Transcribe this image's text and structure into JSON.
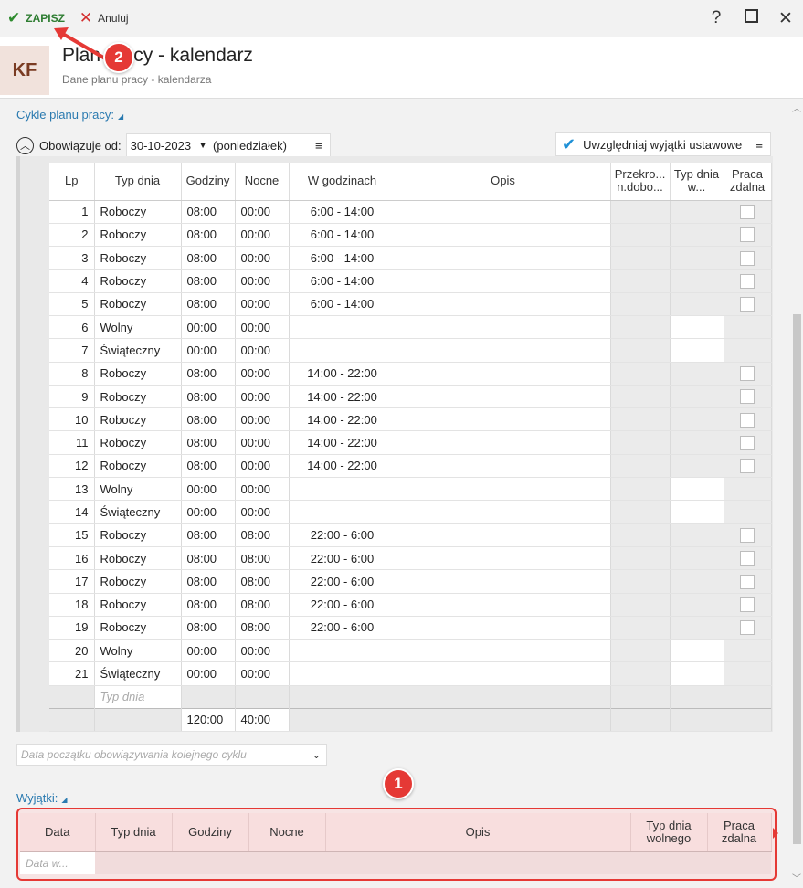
{
  "toolbar": {
    "save_label": "ZAPISZ",
    "cancel_label": "Anuluj",
    "help_label": "?",
    "close_label": "✕"
  },
  "header": {
    "avatar_initials": "KF",
    "title": "Plan pracy - kalendarz",
    "subtitle": "Dane planu pracy - kalendarza"
  },
  "cycles": {
    "section_label": "Cykle planu pracy:",
    "valid_from_label": "Obowiązuje od:",
    "valid_from_date": "30-10-2023",
    "valid_from_day": "(poniedziałek)",
    "include_exceptions_label": "Uwzględniaj wyjątki ustawowe",
    "columns": {
      "lp": "Lp",
      "typ": "Typ dnia",
      "godz": "Godziny",
      "noc": "Nocne",
      "wg": "W godzinach",
      "opis": "Opis",
      "prz": "Przekro... n.dobo...",
      "tdw": "Typ dnia w...",
      "pz": "Praca zdalna"
    },
    "rows": [
      {
        "lp": "1",
        "typ": "Roboczy",
        "godz": "08:00",
        "noc": "00:00",
        "wg": "6:00 - 14:00",
        "remote": true
      },
      {
        "lp": "2",
        "typ": "Roboczy",
        "godz": "08:00",
        "noc": "00:00",
        "wg": "6:00 - 14:00",
        "remote": true
      },
      {
        "lp": "3",
        "typ": "Roboczy",
        "godz": "08:00",
        "noc": "00:00",
        "wg": "6:00 - 14:00",
        "remote": true
      },
      {
        "lp": "4",
        "typ": "Roboczy",
        "godz": "08:00",
        "noc": "00:00",
        "wg": "6:00 - 14:00",
        "remote": true
      },
      {
        "lp": "5",
        "typ": "Roboczy",
        "godz": "08:00",
        "noc": "00:00",
        "wg": "6:00 - 14:00",
        "remote": true
      },
      {
        "lp": "6",
        "typ": "Wolny",
        "godz": "00:00",
        "noc": "00:00",
        "wg": "",
        "remote": false
      },
      {
        "lp": "7",
        "typ": "Świąteczny",
        "godz": "00:00",
        "noc": "00:00",
        "wg": "",
        "remote": false
      },
      {
        "lp": "8",
        "typ": "Roboczy",
        "godz": "08:00",
        "noc": "00:00",
        "wg": "14:00 - 22:00",
        "remote": true
      },
      {
        "lp": "9",
        "typ": "Roboczy",
        "godz": "08:00",
        "noc": "00:00",
        "wg": "14:00 - 22:00",
        "remote": true
      },
      {
        "lp": "10",
        "typ": "Roboczy",
        "godz": "08:00",
        "noc": "00:00",
        "wg": "14:00 - 22:00",
        "remote": true
      },
      {
        "lp": "11",
        "typ": "Roboczy",
        "godz": "08:00",
        "noc": "00:00",
        "wg": "14:00 - 22:00",
        "remote": true
      },
      {
        "lp": "12",
        "typ": "Roboczy",
        "godz": "08:00",
        "noc": "00:00",
        "wg": "14:00 - 22:00",
        "remote": true
      },
      {
        "lp": "13",
        "typ": "Wolny",
        "godz": "00:00",
        "noc": "00:00",
        "wg": "",
        "remote": false
      },
      {
        "lp": "14",
        "typ": "Świąteczny",
        "godz": "00:00",
        "noc": "00:00",
        "wg": "",
        "remote": false
      },
      {
        "lp": "15",
        "typ": "Roboczy",
        "godz": "08:00",
        "noc": "08:00",
        "wg": "22:00 - 6:00",
        "remote": true
      },
      {
        "lp": "16",
        "typ": "Roboczy",
        "godz": "08:00",
        "noc": "08:00",
        "wg": "22:00 - 6:00",
        "remote": true
      },
      {
        "lp": "17",
        "typ": "Roboczy",
        "godz": "08:00",
        "noc": "08:00",
        "wg": "22:00 - 6:00",
        "remote": true
      },
      {
        "lp": "18",
        "typ": "Roboczy",
        "godz": "08:00",
        "noc": "08:00",
        "wg": "22:00 - 6:00",
        "remote": true
      },
      {
        "lp": "19",
        "typ": "Roboczy",
        "godz": "08:00",
        "noc": "08:00",
        "wg": "22:00 - 6:00",
        "remote": true
      },
      {
        "lp": "20",
        "typ": "Wolny",
        "godz": "00:00",
        "noc": "00:00",
        "wg": "",
        "remote": false
      },
      {
        "lp": "21",
        "typ": "Świąteczny",
        "godz": "00:00",
        "noc": "00:00",
        "wg": "",
        "remote": false
      }
    ],
    "new_row_placeholder": "Typ dnia",
    "totals": {
      "godz": "120:00",
      "noc": "40:00"
    },
    "next_cycle_placeholder": "Data początku obowiązywania kolejnego cyklu"
  },
  "exceptions": {
    "section_label": "Wyjątki:",
    "columns": {
      "data": "Data",
      "typ": "Typ dnia",
      "godz": "Godziny",
      "noc": "Nocne",
      "opis": "Opis",
      "tdw": "Typ dnia wolnego",
      "pz": "Praca zdalna"
    },
    "new_row_placeholder": "Data w..."
  },
  "annotations": {
    "badge_1": "1",
    "badge_2": "2"
  },
  "colors": {
    "accent": "#2a7ab0",
    "save_green": "#2e7d32",
    "annotation_red": "#e53935"
  }
}
